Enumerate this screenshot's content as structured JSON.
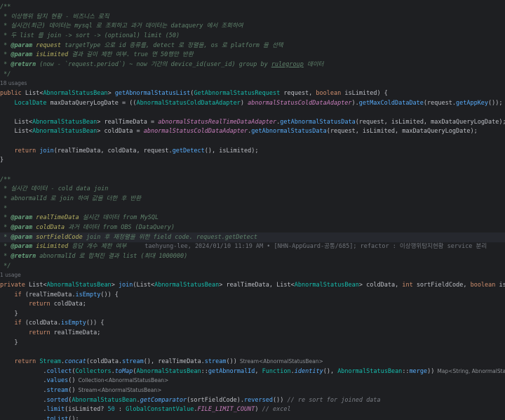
{
  "editor": {
    "language": "java",
    "highlighted_line": 24,
    "lines": [
      {
        "tokens": [
          {
            "t": "/**",
            "c": "doc"
          }
        ]
      },
      {
        "tokens": [
          {
            "t": " * 이상행위 탐지 현황 - 비즈니스 로직",
            "c": "doc"
          }
        ]
      },
      {
        "tokens": [
          {
            "t": " * 실시간(최근) 데이터는 mysql 로 조회하고 과거 데이터는 dataquery 에서 조회하여",
            "c": "doc"
          }
        ]
      },
      {
        "tokens": [
          {
            "t": " * 두 list 를 join -> sort -> (optional) limit (50)",
            "c": "doc"
          }
        ]
      },
      {
        "tokens": [
          {
            "t": " * ",
            "c": "doc"
          },
          {
            "t": "@param",
            "c": "tag"
          },
          {
            "t": " ",
            "c": "doc"
          },
          {
            "t": "request",
            "c": "prm"
          },
          {
            "t": " targetType 으로 id 종류를, detect 로 정렬을, os 로 platform 을 선택",
            "c": "doc"
          }
        ]
      },
      {
        "tokens": [
          {
            "t": " * ",
            "c": "doc"
          },
          {
            "t": "@param",
            "c": "tag"
          },
          {
            "t": " ",
            "c": "doc"
          },
          {
            "t": "isLimited",
            "c": "prm"
          },
          {
            "t": " 결과 길이 제한 여부. true 면 50행만 반환",
            "c": "doc"
          }
        ]
      },
      {
        "tokens": [
          {
            "t": " * ",
            "c": "doc"
          },
          {
            "t": "@return",
            "c": "tag"
          },
          {
            "t": " (now - `request.period`) ~ now 기간의 device_id(user_id) group by ",
            "c": "doc"
          },
          {
            "t": "rulegroup",
            "c": "doc ul"
          },
          {
            "t": " 데이터",
            "c": "doc"
          }
        ]
      },
      {
        "tokens": [
          {
            "t": " */",
            "c": "doc"
          }
        ]
      },
      {
        "tokens": [
          {
            "t": "18 usages",
            "c": "usage"
          }
        ]
      },
      {
        "tokens": [
          {
            "t": "public ",
            "c": "kw"
          },
          {
            "t": "List",
            "c": "ty"
          },
          {
            "t": "<",
            "c": "pl"
          },
          {
            "t": "AbnormalStatusBean",
            "c": "gen"
          },
          {
            "t": "> ",
            "c": "pl"
          },
          {
            "t": "getAbnormalStatusList",
            "c": "meth"
          },
          {
            "t": "(",
            "c": "pl"
          },
          {
            "t": "GetAbnormalStatusRequest",
            "c": "gen"
          },
          {
            "t": " request, ",
            "c": "par"
          },
          {
            "t": "boolean ",
            "c": "kw"
          },
          {
            "t": "isLimited",
            "c": "par"
          },
          {
            "t": ") {",
            "c": "pl"
          }
        ]
      },
      {
        "tokens": [
          {
            "t": "    ",
            "c": "pl"
          },
          {
            "t": "LocalDate",
            "c": "gen"
          },
          {
            "t": " maxDataQueryLogDate = ((",
            "c": "lv"
          },
          {
            "t": "AbnormalStatusColdDataAdapter",
            "c": "gen"
          },
          {
            "t": ") ",
            "c": "pl"
          },
          {
            "t": "abnormalStatusColdDataAdapter",
            "c": "cnst"
          },
          {
            "t": ").",
            "c": "pl"
          },
          {
            "t": "getMaxColdDataDate",
            "c": "call"
          },
          {
            "t": "(request.",
            "c": "pl"
          },
          {
            "t": "getAppKey",
            "c": "call"
          },
          {
            "t": "());",
            "c": "pl"
          }
        ]
      },
      {
        "tokens": []
      },
      {
        "tokens": [
          {
            "t": "    ",
            "c": "pl"
          },
          {
            "t": "List",
            "c": "ty"
          },
          {
            "t": "<",
            "c": "pl"
          },
          {
            "t": "AbnormalStatusBean",
            "c": "gen"
          },
          {
            "t": "> realTimeData = ",
            "c": "pl"
          },
          {
            "t": "abnormalStatusRealTimeDataAdapter",
            "c": "cnst"
          },
          {
            "t": ".",
            "c": "pl"
          },
          {
            "t": "getAbnormalStatusData",
            "c": "call"
          },
          {
            "t": "(request, isLimited, maxDataQueryLogDate);",
            "c": "pl"
          }
        ]
      },
      {
        "tokens": [
          {
            "t": "    ",
            "c": "pl"
          },
          {
            "t": "List",
            "c": "ty"
          },
          {
            "t": "<",
            "c": "pl"
          },
          {
            "t": "AbnormalStatusBean",
            "c": "gen"
          },
          {
            "t": "> coldData = ",
            "c": "pl"
          },
          {
            "t": "abnormalStatusColdDataAdapter",
            "c": "cnst"
          },
          {
            "t": ".",
            "c": "pl"
          },
          {
            "t": "getAbnormalStatusData",
            "c": "call"
          },
          {
            "t": "(request, isLimited, maxDataQueryLogDate);",
            "c": "pl"
          }
        ]
      },
      {
        "tokens": []
      },
      {
        "tokens": [
          {
            "t": "    ",
            "c": "pl"
          },
          {
            "t": "return ",
            "c": "kw"
          },
          {
            "t": "join",
            "c": "call"
          },
          {
            "t": "(realTimeData, coldData, request.",
            "c": "pl"
          },
          {
            "t": "getDetect",
            "c": "call"
          },
          {
            "t": "(), isLimited);",
            "c": "pl"
          }
        ]
      },
      {
        "tokens": [
          {
            "t": "}",
            "c": "pl"
          }
        ]
      },
      {
        "tokens": []
      },
      {
        "tokens": [
          {
            "t": "/**",
            "c": "doc"
          }
        ]
      },
      {
        "tokens": [
          {
            "t": " * 실시간 데이터 - cold data join",
            "c": "doc"
          }
        ]
      },
      {
        "tokens": [
          {
            "t": " * abnormalId 로 join 하여 값을 더한 후 반환",
            "c": "doc"
          }
        ]
      },
      {
        "tokens": [
          {
            "t": " *",
            "c": "doc"
          }
        ]
      },
      {
        "tokens": [
          {
            "t": " * ",
            "c": "doc"
          },
          {
            "t": "@param",
            "c": "tag"
          },
          {
            "t": " ",
            "c": "doc"
          },
          {
            "t": "realTimeData",
            "c": "prm"
          },
          {
            "t": " 실시간 데이터 from MySQL",
            "c": "doc"
          }
        ]
      },
      {
        "tokens": [
          {
            "t": " * ",
            "c": "doc"
          },
          {
            "t": "@param",
            "c": "tag"
          },
          {
            "t": " ",
            "c": "doc"
          },
          {
            "t": "coldData",
            "c": "prm"
          },
          {
            "t": " 과거 데이터 from OBS (DataQuery)",
            "c": "doc"
          }
        ]
      },
      {
        "tokens": [
          {
            "t": " * ",
            "c": "doc"
          },
          {
            "t": "@param",
            "c": "tag"
          },
          {
            "t": " ",
            "c": "doc"
          },
          {
            "t": "sortFieldCode",
            "c": "prm"
          },
          {
            "t": " join 후 재정렬을 위한 field code. request.getDetect",
            "c": "doc"
          }
        ]
      },
      {
        "tokens": [
          {
            "t": " * ",
            "c": "doc"
          },
          {
            "t": "@param",
            "c": "tag"
          },
          {
            "t": " ",
            "c": "doc"
          },
          {
            "t": "isLimited",
            "c": "prm"
          },
          {
            "t": " 응답 개수 제한 여부",
            "c": "doc"
          },
          {
            "t": "taehyung-lee, 2024/01/10 11:19 AM • [NHN-AppGuard-공통/685]; refactor : 이상행위탐지현황 service 분리",
            "c": "blame"
          }
        ]
      },
      {
        "tokens": [
          {
            "t": " * ",
            "c": "doc"
          },
          {
            "t": "@return",
            "c": "tag"
          },
          {
            "t": " abnormalId 로 합쳐진 결과 list (최대 1000000)",
            "c": "doc"
          }
        ]
      },
      {
        "tokens": [
          {
            "t": " */",
            "c": "doc"
          }
        ]
      },
      {
        "tokens": [
          {
            "t": "1 usage",
            "c": "usage"
          }
        ]
      },
      {
        "tokens": [
          {
            "t": "private ",
            "c": "kw"
          },
          {
            "t": "List",
            "c": "ty"
          },
          {
            "t": "<",
            "c": "pl"
          },
          {
            "t": "AbnormalStatusBean",
            "c": "gen"
          },
          {
            "t": "> ",
            "c": "pl"
          },
          {
            "t": "join",
            "c": "meth"
          },
          {
            "t": "(",
            "c": "pl"
          },
          {
            "t": "List",
            "c": "ty"
          },
          {
            "t": "<",
            "c": "pl"
          },
          {
            "t": "AbnormalStatusBean",
            "c": "gen"
          },
          {
            "t": "> realTimeData, ",
            "c": "pl"
          },
          {
            "t": "List",
            "c": "ty"
          },
          {
            "t": "<",
            "c": "pl"
          },
          {
            "t": "AbnormalStatusBean",
            "c": "gen"
          },
          {
            "t": "> coldData, ",
            "c": "pl"
          },
          {
            "t": "int ",
            "c": "kw"
          },
          {
            "t": "sortFieldCode, ",
            "c": "pl"
          },
          {
            "t": "boolean ",
            "c": "kw"
          },
          {
            "t": "isLimited) {",
            "c": "pl"
          }
        ]
      },
      {
        "tokens": [
          {
            "t": "    ",
            "c": "pl"
          },
          {
            "t": "if ",
            "c": "kw"
          },
          {
            "t": "(realTimeData.",
            "c": "pl"
          },
          {
            "t": "isEmpty",
            "c": "call"
          },
          {
            "t": "()) {",
            "c": "pl"
          }
        ]
      },
      {
        "tokens": [
          {
            "t": "        ",
            "c": "pl"
          },
          {
            "t": "return ",
            "c": "kw"
          },
          {
            "t": "coldData;",
            "c": "pl"
          }
        ]
      },
      {
        "tokens": [
          {
            "t": "    }",
            "c": "pl"
          }
        ]
      },
      {
        "tokens": [
          {
            "t": "    ",
            "c": "pl"
          },
          {
            "t": "if ",
            "c": "kw"
          },
          {
            "t": "(coldData.",
            "c": "pl"
          },
          {
            "t": "isEmpty",
            "c": "call"
          },
          {
            "t": "()) {",
            "c": "pl"
          }
        ]
      },
      {
        "tokens": [
          {
            "t": "        ",
            "c": "pl"
          },
          {
            "t": "return ",
            "c": "kw"
          },
          {
            "t": "realTimeData;",
            "c": "pl"
          }
        ]
      },
      {
        "tokens": [
          {
            "t": "    }",
            "c": "pl"
          }
        ]
      },
      {
        "tokens": []
      },
      {
        "tokens": [
          {
            "t": "    ",
            "c": "pl"
          },
          {
            "t": "return ",
            "c": "kw"
          },
          {
            "t": "Stream",
            "c": "gen"
          },
          {
            "t": ".",
            "c": "pl"
          },
          {
            "t": "concat",
            "c": "call st"
          },
          {
            "t": "(coldData.",
            "c": "pl"
          },
          {
            "t": "stream",
            "c": "call"
          },
          {
            "t": "(), realTimeData.",
            "c": "pl"
          },
          {
            "t": "stream",
            "c": "call"
          },
          {
            "t": "())",
            "c": "pl"
          },
          {
            "t": "Stream<AbnormalStatusBean>",
            "c": "hint"
          }
        ]
      },
      {
        "tokens": [
          {
            "t": "            .",
            "c": "pl"
          },
          {
            "t": "collect",
            "c": "call"
          },
          {
            "t": "(",
            "c": "pl"
          },
          {
            "t": "Collectors",
            "c": "gen"
          },
          {
            "t": ".",
            "c": "pl"
          },
          {
            "t": "toMap",
            "c": "call st"
          },
          {
            "t": "(",
            "c": "pl"
          },
          {
            "t": "AbnormalStatusBean",
            "c": "gen"
          },
          {
            "t": "::",
            "c": "pl"
          },
          {
            "t": "getAbnormalId",
            "c": "call"
          },
          {
            "t": ", ",
            "c": "pl"
          },
          {
            "t": "Function",
            "c": "gen"
          },
          {
            "t": ".",
            "c": "pl"
          },
          {
            "t": "identity",
            "c": "call st"
          },
          {
            "t": "(), ",
            "c": "pl"
          },
          {
            "t": "AbnormalStatusBean",
            "c": "gen"
          },
          {
            "t": "::",
            "c": "pl"
          },
          {
            "t": "merge",
            "c": "call"
          },
          {
            "t": "))",
            "c": "pl"
          },
          {
            "t": "Map<String, AbnormalStatusBean>",
            "c": "hint"
          }
        ]
      },
      {
        "tokens": [
          {
            "t": "            .",
            "c": "pl"
          },
          {
            "t": "values",
            "c": "call"
          },
          {
            "t": "()",
            "c": "pl"
          },
          {
            "t": "Collection<AbnormalStatusBean>",
            "c": "hint"
          }
        ]
      },
      {
        "tokens": [
          {
            "t": "            .",
            "c": "pl"
          },
          {
            "t": "stream",
            "c": "call"
          },
          {
            "t": "()",
            "c": "pl"
          },
          {
            "t": "Stream<AbnormalStatusBean>",
            "c": "hint"
          }
        ]
      },
      {
        "tokens": [
          {
            "t": "            .",
            "c": "pl"
          },
          {
            "t": "sorted",
            "c": "call"
          },
          {
            "t": "(",
            "c": "pl"
          },
          {
            "t": "AbnormalStatusBean",
            "c": "gen"
          },
          {
            "t": ".",
            "c": "pl"
          },
          {
            "t": "getComparator",
            "c": "call st"
          },
          {
            "t": "(sortFieldCode).",
            "c": "pl"
          },
          {
            "t": "reversed",
            "c": "call"
          },
          {
            "t": "()) ",
            "c": "pl"
          },
          {
            "t": "// re sort for joined data",
            "c": "cmt"
          }
        ]
      },
      {
        "tokens": [
          {
            "t": "            .",
            "c": "pl"
          },
          {
            "t": "limit",
            "c": "call"
          },
          {
            "t": "(isLimited? ",
            "c": "pl"
          },
          {
            "t": "50",
            "c": "num"
          },
          {
            "t": " : ",
            "c": "pl"
          },
          {
            "t": "GlobalConstantValue",
            "c": "gen"
          },
          {
            "t": ".",
            "c": "pl"
          },
          {
            "t": "FILE_LIMIT_COUNT",
            "c": "cnst"
          },
          {
            "t": ") ",
            "c": "pl"
          },
          {
            "t": "// excel",
            "c": "cmt"
          }
        ]
      },
      {
        "tokens": [
          {
            "t": "            .",
            "c": "pl"
          },
          {
            "t": "toList",
            "c": "call"
          },
          {
            "t": "();",
            "c": "pl"
          }
        ]
      },
      {
        "tokens": [
          {
            "t": "}",
            "c": "pl"
          }
        ]
      }
    ]
  }
}
